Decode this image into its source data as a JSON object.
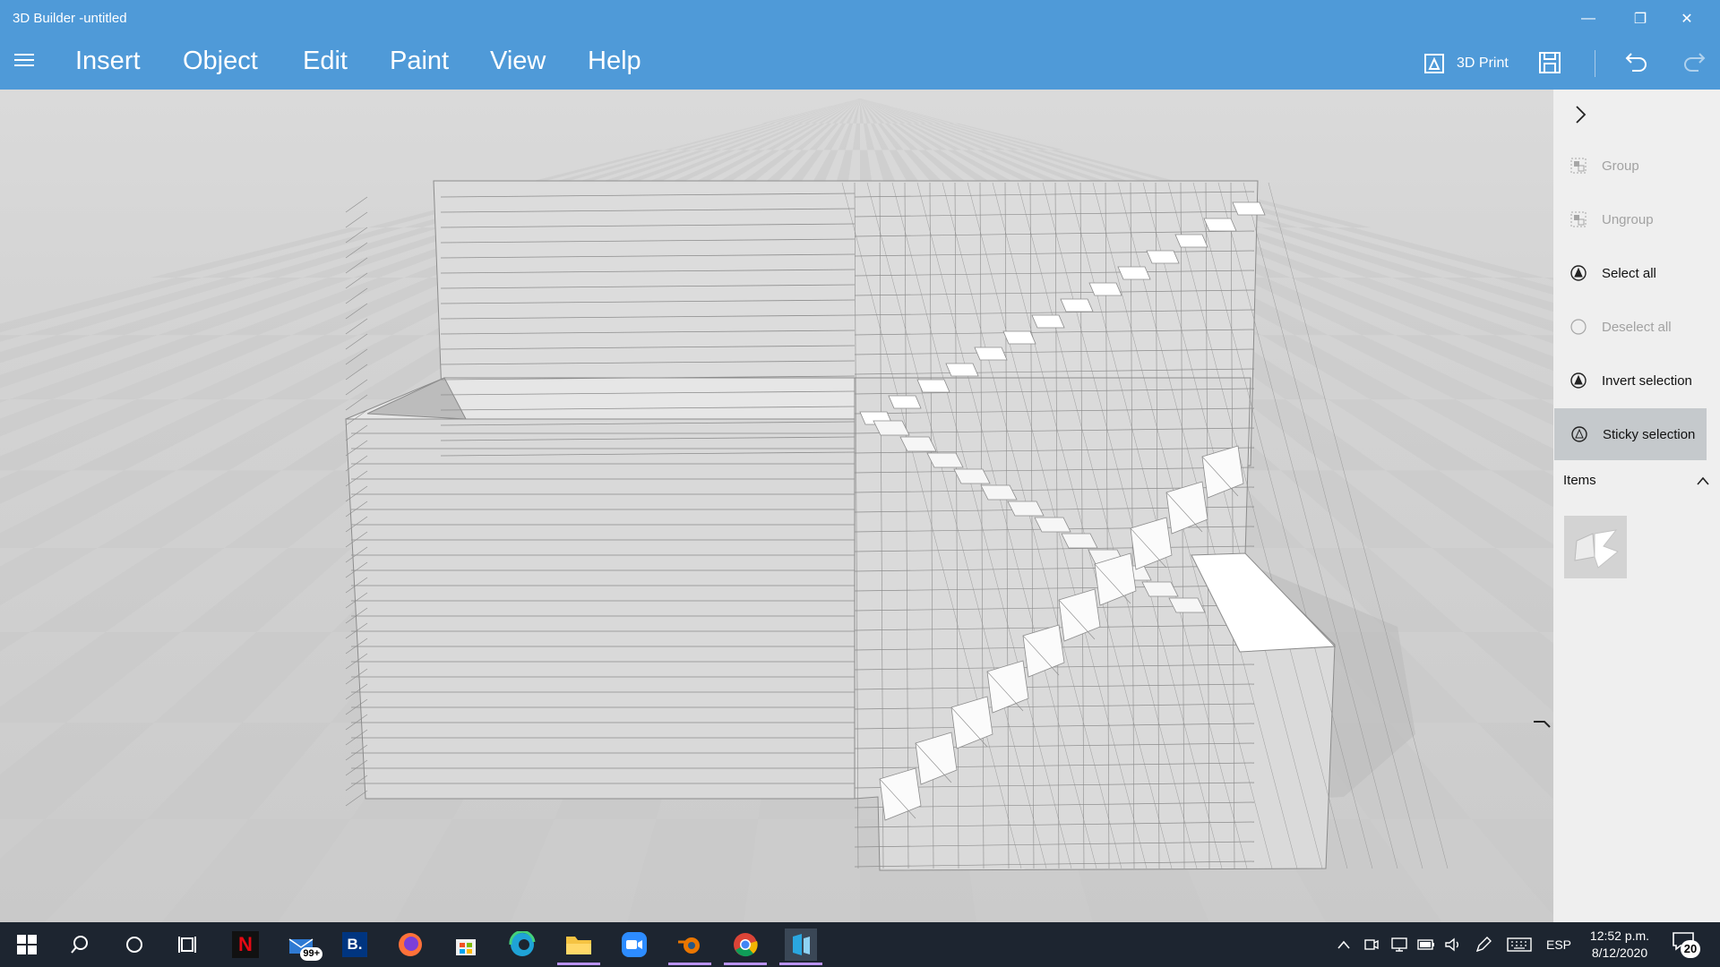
{
  "window": {
    "title": "3D Builder -untitled",
    "minimize_glyph": "—",
    "maximize_glyph": "❐",
    "close_glyph": "✕"
  },
  "menu": [
    "Insert",
    "Object",
    "Edit",
    "Paint",
    "View",
    "Help"
  ],
  "toolbar": {
    "print_label": "3D Print",
    "save_icon": "save-icon",
    "undo_icon": "undo-icon",
    "redo_icon": "redo-icon"
  },
  "panel": {
    "items": [
      {
        "label": "Group",
        "icon": "group-icon",
        "state": "disabled"
      },
      {
        "label": "Ungroup",
        "icon": "ungroup-icon",
        "state": "disabled"
      },
      {
        "label": "Select all",
        "icon": "select-all-icon",
        "state": "enabled"
      },
      {
        "label": "Deselect all",
        "icon": "deselect-all-icon",
        "state": "disabled"
      },
      {
        "label": "Invert selection",
        "icon": "invert-selection-icon",
        "state": "enabled"
      },
      {
        "label": "Sticky selection",
        "icon": "sticky-selection-icon",
        "state": "active"
      }
    ],
    "items_header": "Items"
  },
  "taskbar": {
    "apps": [
      "start-icon",
      "search-icon",
      "cortana-icon",
      "task-view-icon",
      "netflix-icon",
      "mail-icon",
      "booking-icon",
      "firefox-icon",
      "store-icon",
      "edge-icon",
      "file-explorer-icon",
      "zoom-icon",
      "blender-icon",
      "chrome-icon",
      "3d-builder-icon"
    ],
    "mail_badge": "99+",
    "booking_letter": "B.",
    "netflix_letter": "N",
    "language": "ESP",
    "time": "12:52 p.m.",
    "date": "8/12/2020",
    "notification_count": "20"
  },
  "colors": {
    "title_bar": "#4f9ad8",
    "panel": "#efefef",
    "panel_active": "#c5c9cc",
    "taskbar": "#1d2530",
    "accent_underline": "#b993f0"
  }
}
